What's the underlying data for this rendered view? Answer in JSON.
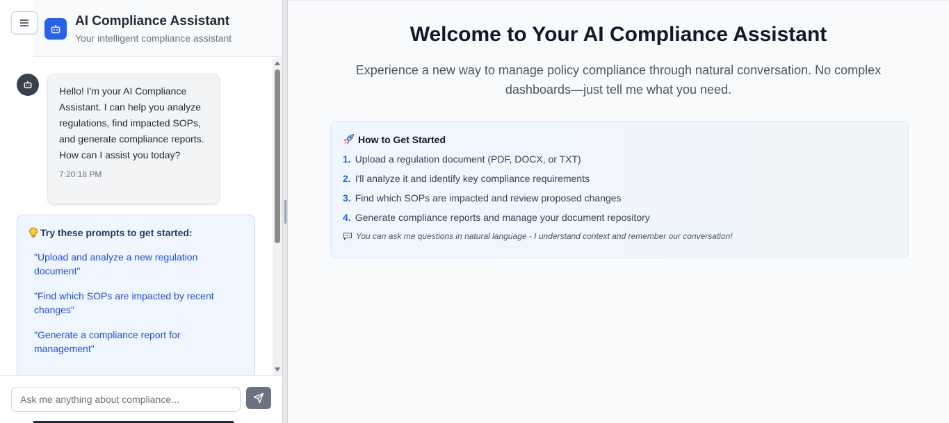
{
  "header": {
    "title": "AI Compliance Assistant",
    "subtitle": "Your intelligent compliance assistant",
    "menu_icon": "hamburger-icon",
    "logo_icon": "robot-icon"
  },
  "chat": {
    "messages": [
      {
        "sender_icon": "robot-icon",
        "text": "Hello! I'm your AI Compliance Assistant. I can help you analyze regulations, find impacted SOPs, and generate compliance reports. How can I assist you today?",
        "time": "7:20:18 PM"
      }
    ],
    "prompts": {
      "icon": "lightbulb-icon",
      "title": "Try these prompts to get started:",
      "items": [
        "\"Upload and analyze a new regulation document\"",
        "\"Find which SOPs are impacted by recent changes\"",
        "\"Generate a compliance report for management\""
      ]
    },
    "input": {
      "placeholder": "Ask me anything about compliance...",
      "value": ""
    },
    "send_icon": "send-icon"
  },
  "main": {
    "title": "Welcome to Your AI Compliance Assistant",
    "description": "Experience a new way to manage policy compliance through natural conversation. No complex dashboards—just tell me what you need.",
    "getting_started": {
      "icon": "rocket-icon",
      "title": "How to Get Started",
      "steps": [
        {
          "num": "1.",
          "text": "Upload a regulation document (PDF, DOCX, or TXT)"
        },
        {
          "num": "2.",
          "text": "I'll analyze it and identify key compliance requirements"
        },
        {
          "num": "3.",
          "text": "Find which SOPs are impacted and review proposed changes"
        },
        {
          "num": "4.",
          "text": "Generate compliance reports and manage your document repository"
        }
      ],
      "note_icon": "chat-bubble-icon",
      "note": "You can ask me questions in natural language - I understand context and remember our conversation!"
    }
  },
  "colors": {
    "accent": "#2563eb",
    "prompt_link": "#1d4ed8",
    "send_button": "#6b7280"
  }
}
